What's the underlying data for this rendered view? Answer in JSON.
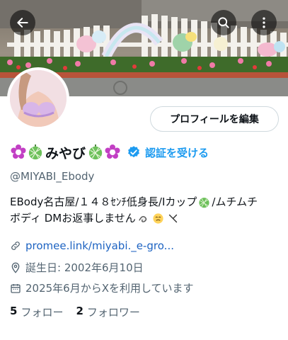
{
  "profile": {
    "edit_label": "プロフィールを編集",
    "name": "みやび",
    "verify_label": "認証を受ける",
    "handle": "@MIYABI_Ebody",
    "bio_line1": "EBody名古屋/１４８ｾﾝﾁ低身長/Iカップ",
    "bio_line1_tail": "/ムチムチ",
    "bio_line2": "ボディ DMお返事しません",
    "link": "promee.link/miyabi._e-gro...",
    "birthday": "誕生日: 2002年6月10日",
    "joined": "2025年6月からXを利用しています",
    "following_count": "5",
    "following_label": "フォロー",
    "followers_count": "2",
    "followers_label": "フォロワー"
  },
  "icons": [
    "back-arrow-icon",
    "search-icon",
    "more-vertical-icon",
    "flower-icon",
    "melon-icon",
    "verified-badge-icon",
    "link-icon",
    "location-pin-icon",
    "calendar-icon"
  ],
  "colors": {
    "accent": "#1d9bf0",
    "link": "#1d63c2",
    "secondary_text": "#536471",
    "flower": "#c23fc4",
    "melon": "#5bb84d"
  }
}
